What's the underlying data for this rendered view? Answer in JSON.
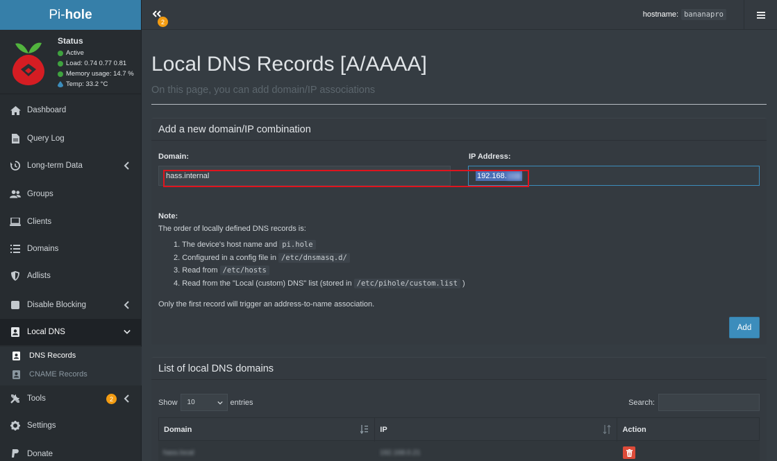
{
  "brand": {
    "prefix": "Pi-",
    "bold": "hole"
  },
  "status": {
    "title": "Status",
    "active": "Active",
    "load": "Load:  0.74  0.77  0.81",
    "memory": "Memory usage:  14.7 %",
    "temp": "Temp: 33.2 °C"
  },
  "nav": {
    "dashboard": "Dashboard",
    "query_log": "Query Log",
    "long_term": "Long-term Data",
    "groups": "Groups",
    "clients": "Clients",
    "domains": "Domains",
    "adlists": "Adlists",
    "disable_blocking": "Disable Blocking",
    "local_dns": "Local DNS",
    "dns_records": "DNS Records",
    "cname_records": "CNAME Records",
    "tools": "Tools",
    "tools_badge": "2",
    "settings": "Settings",
    "donate": "Donate"
  },
  "topbar": {
    "toggle_badge": "2",
    "hostname_label": "hostname:",
    "hostname_value": "bananapro"
  },
  "page": {
    "title": "Local DNS Records [A/AAAA]",
    "subtitle": "On this page, you can add domain/IP associations"
  },
  "add_box": {
    "header": "Add a new domain/IP combination",
    "domain_label": "Domain:",
    "domain_value": "hass.internal",
    "ip_label": "IP Address:",
    "ip_value": "192.168.",
    "note_title": "Note:",
    "note_intro": "The order of locally defined DNS records is:",
    "order": [
      {
        "text": "1. The device's host name and",
        "code": "pi.hole",
        "after": ""
      },
      {
        "text": "2. Configured in a config file in",
        "code": "/etc/dnsmasq.d/",
        "after": ""
      },
      {
        "text": "3. Read from",
        "code": "/etc/hosts",
        "after": ""
      },
      {
        "text": "4. Read from the \"Local (custom) DNS\" list (stored in",
        "code": "/etc/pihole/custom.list",
        "after": ")"
      }
    ],
    "note_footer": "Only the first record will trigger an address-to-name association.",
    "add_button": "Add"
  },
  "list_box": {
    "header": "List of local DNS domains",
    "show_label": "Show",
    "show_value": "10",
    "entries_label": "entries",
    "search_label": "Search:",
    "columns": {
      "domain": "Domain",
      "ip": "IP",
      "action": "Action"
    },
    "rows": [
      {
        "domain": "hass.local",
        "ip": "192.168.0.21"
      }
    ]
  },
  "colors": {
    "brand_bg": "#367fa9",
    "accent": "#3c8dbc",
    "badge": "#f39c12",
    "danger": "#dd4b39",
    "highlight": "#e0141e"
  }
}
